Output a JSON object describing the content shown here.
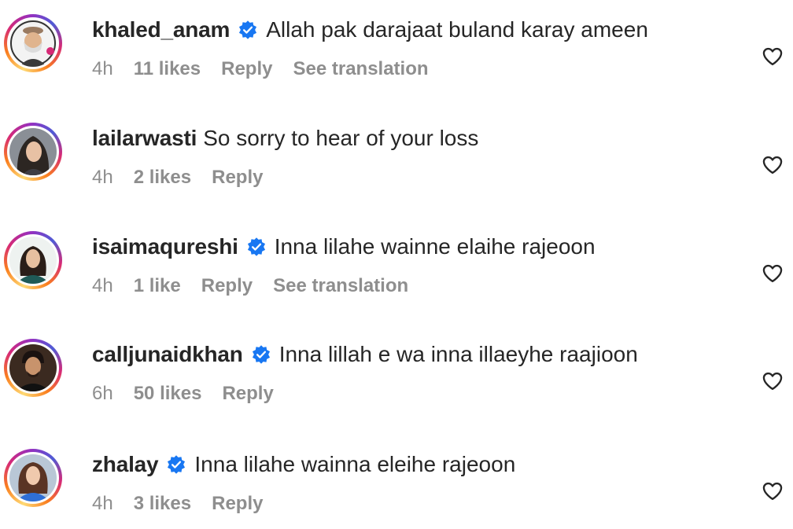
{
  "colors": {
    "text": "#262626",
    "secondary": "#8e8e8e",
    "verified_blue": "#1877f2",
    "story_ring": [
      "#feda75",
      "#fa7e1e",
      "#d62976",
      "#962fbf",
      "#4f5bd5"
    ]
  },
  "comments": [
    {
      "username": "khaled_anam",
      "verified": true,
      "text": "Allah pak darajaat buland karay ameen",
      "time": "4h",
      "likes": "11 likes",
      "reply": "Reply",
      "translation": "See translation",
      "avatar_icon": "avatar-khaled-anam"
    },
    {
      "username": "lailarwasti",
      "verified": false,
      "text": "So sorry to hear of your loss",
      "time": "4h",
      "likes": "2 likes",
      "reply": "Reply",
      "avatar_icon": "avatar-lailarwasti"
    },
    {
      "username": "isaimaqureshi",
      "verified": true,
      "text": "Inna lilahe wainne elaihe rajeoon",
      "time": "4h",
      "likes": "1 like",
      "reply": "Reply",
      "translation": "See translation",
      "avatar_icon": "avatar-isaimaqureshi"
    },
    {
      "username": "calljunaidkhan",
      "verified": true,
      "text": "Inna lillah e wa inna illaeyhe raajioon",
      "time": "6h",
      "likes": "50 likes",
      "reply": "Reply",
      "avatar_icon": "avatar-calljunaidkhan"
    },
    {
      "username": "zhalay",
      "verified": true,
      "text": "Inna lilahe wainna eleihe rajeoon",
      "time": "4h",
      "likes": "3 likes",
      "reply": "Reply",
      "avatar_icon": "avatar-zhalay"
    }
  ]
}
